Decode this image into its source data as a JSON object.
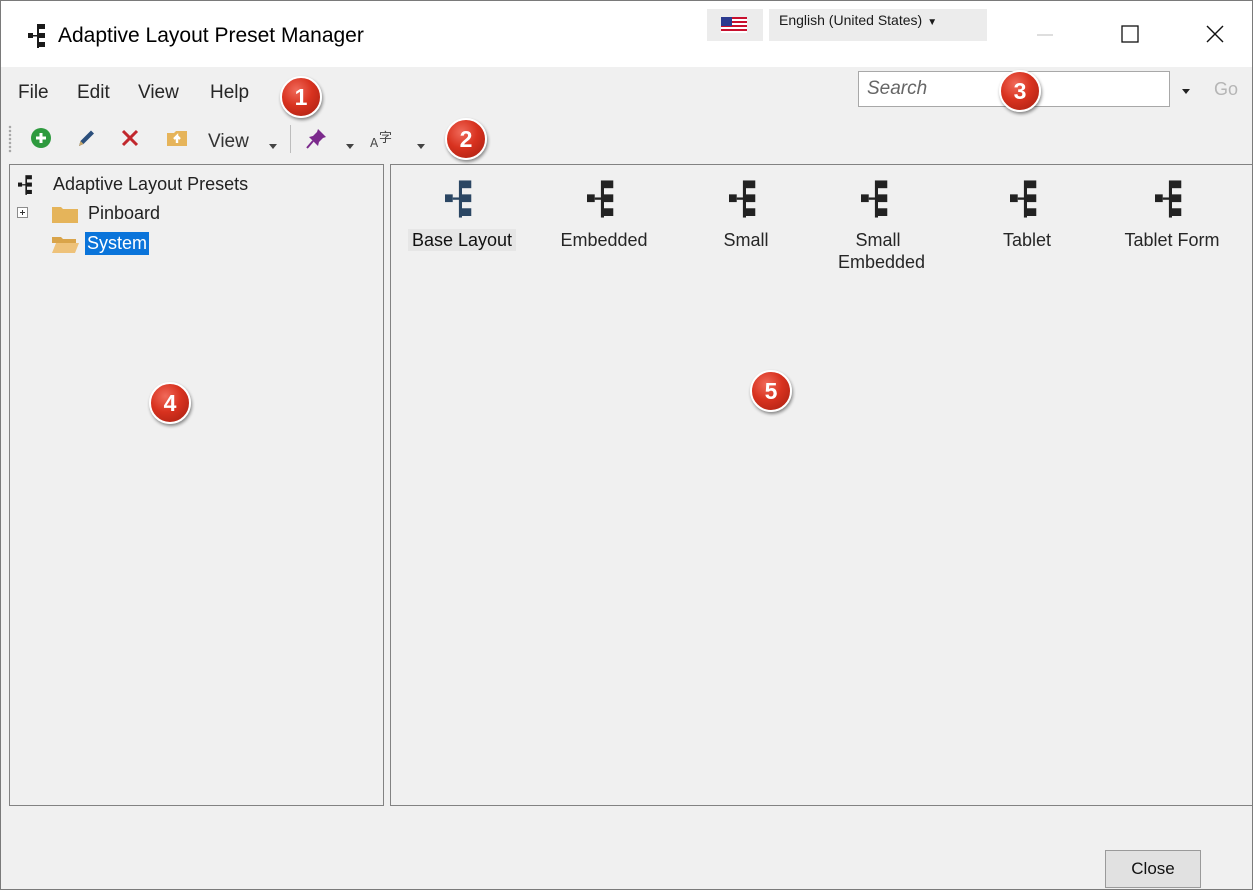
{
  "window": {
    "title": "Adaptive Layout Preset Manager",
    "language": "English (United States)",
    "controls": {
      "minimize": "minimize-icon",
      "maximize": "maximize-icon",
      "close": "close-icon"
    }
  },
  "menu": {
    "items": [
      "File",
      "Edit",
      "View",
      "Help"
    ]
  },
  "search": {
    "placeholder": "Search",
    "go_label": "Go"
  },
  "toolbar": {
    "view_label": "View",
    "buttons": [
      "add-icon",
      "edit-icon",
      "delete-icon",
      "folder-up-icon",
      "pin-icon",
      "language-font-icon"
    ]
  },
  "tree": {
    "root": "Adaptive Layout Presets",
    "items": [
      {
        "label": "Pinboard",
        "expandable": true,
        "selected": false
      },
      {
        "label": "System",
        "expandable": false,
        "selected": true
      }
    ]
  },
  "tiles": [
    {
      "label": "Base Layout",
      "active": true
    },
    {
      "label": "Embedded",
      "active": false
    },
    {
      "label": "Small",
      "active": false
    },
    {
      "label": "Small Embedded",
      "active": false
    },
    {
      "label": "Tablet",
      "active": false
    },
    {
      "label": "Tablet Form",
      "active": false
    }
  ],
  "callouts": [
    "1",
    "2",
    "3",
    "4",
    "5"
  ],
  "footer": {
    "close_label": "Close"
  },
  "colors": {
    "selection": "#0a74da",
    "callout": "#d8321f",
    "add_green": "#2e9a3e",
    "delete_red": "#c1272d",
    "pin_purple": "#7b2a8c",
    "tile_active": "#2b4663"
  }
}
